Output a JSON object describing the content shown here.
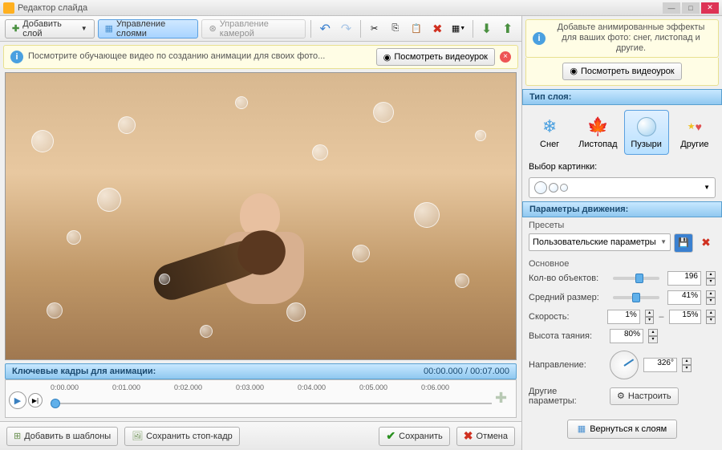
{
  "titlebar": {
    "title": "Редактор слайда"
  },
  "toolbar": {
    "add_layer": "Добавить слой",
    "manage_layers": "Управление слоями",
    "manage_camera": "Управление камерой"
  },
  "hint_left": {
    "text": "Посмотрите обучающее видео по созданию анимации для своих фото...",
    "watch": "Посмотреть видеоурок"
  },
  "hint_right": {
    "text": "Добавьте анимированные эффекты для ваших фото: снег, листопад и другие.",
    "watch": "Посмотреть видеоурок"
  },
  "timeline": {
    "title": "Ключевые кадры для анимации:",
    "current": "00:00.000",
    "total": "00:07.000",
    "ticks": [
      "0:00.000",
      "0:01.000",
      "0:02.000",
      "0:03.000",
      "0:04.000",
      "0:05.000",
      "0:06.000"
    ]
  },
  "bottom": {
    "add_template": "Добавить в шаблоны",
    "save_frame": "Сохранить стоп-кадр",
    "save": "Сохранить",
    "cancel": "Отмена"
  },
  "panel": {
    "layer_type_hdr": "Тип слоя:",
    "types": {
      "snow": "Снег",
      "fall": "Листопад",
      "bubbles": "Пузыри",
      "other": "Другие"
    },
    "pick_image": "Выбор картинки:",
    "motion_hdr": "Параметры движения:",
    "presets_lbl": "Пресеты",
    "preset_value": "Пользовательские параметры",
    "main_lbl": "Основное",
    "count_lbl": "Кол-во объектов:",
    "count_val": "196",
    "size_lbl": "Средний размер:",
    "size_val": "41%",
    "speed_lbl": "Скорость:",
    "speed_from": "1%",
    "speed_to": "15%",
    "melt_lbl": "Высота таяния:",
    "melt_val": "80%",
    "dir_lbl": "Направление:",
    "dir_val": "326°",
    "other_lbl": "Другие параметры:",
    "configure": "Настроить",
    "back": "Вернуться к слоям"
  }
}
